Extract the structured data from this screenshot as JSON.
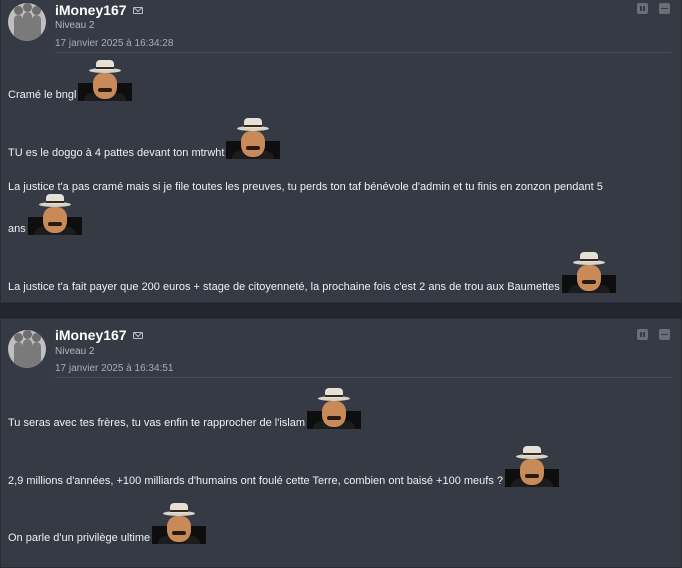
{
  "posts": [
    {
      "username": "iMoney167",
      "level": "Niveau 2",
      "date": "17 janvier 2025 à 16:34:28",
      "lines": [
        "Cramé le bngl",
        "TU es le doggo à 4 pattes devant ton mtrwht",
        "La justice t'a pas cramé mais si je file toutes les preuves, tu perds ton taf bénévole d'admin et tu finis en zonzon pendant 5",
        "ans",
        "La justice t'a fait payer que 200 euros + stage de citoyenneté, la prochaine fois c'est 2 ans de trou aux Baumettes"
      ]
    },
    {
      "username": "iMoney167",
      "level": "Niveau 2",
      "date": "17 janvier 2025 à 16:34:51",
      "lines": [
        "Tu seras avec tes frères, tu vas enfin te rapprocher de l'islam",
        "2,9 millions d'années, +100 milliards d'humains ont foulé cette Terre, combien ont baisé +100 meufs ?",
        "On parle d'un privilège ultime"
      ]
    }
  ],
  "icons": {
    "avatar": "default-avatar-icon",
    "mail": "mail-icon",
    "emoji": "risitas-sticker"
  },
  "colors": {
    "background": "#23262e",
    "post": "#363a44",
    "text": "#f0f0f2",
    "meta": "#b6b9c0"
  }
}
